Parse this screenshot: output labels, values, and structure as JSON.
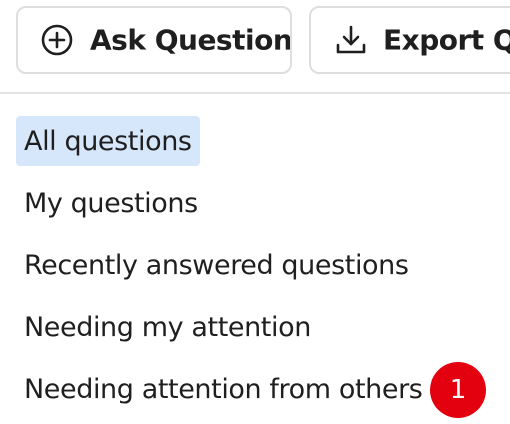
{
  "toolbar": {
    "ask_question": {
      "label": "Ask Question",
      "icon": "plus-circle-icon"
    },
    "export_qa": {
      "label": "Export Q&A",
      "icon": "download-icon"
    }
  },
  "nav": {
    "items": [
      {
        "label": "All questions",
        "active": true
      },
      {
        "label": "My questions",
        "active": false
      },
      {
        "label": "Recently answered questions",
        "active": false
      },
      {
        "label": "Needing my attention",
        "active": false
      },
      {
        "label": "Needing attention from others",
        "active": false,
        "badge": "1"
      }
    ]
  },
  "colors": {
    "active_background": "#d6e6fb",
    "badge_background": "#e3000f",
    "border": "#dedede"
  }
}
